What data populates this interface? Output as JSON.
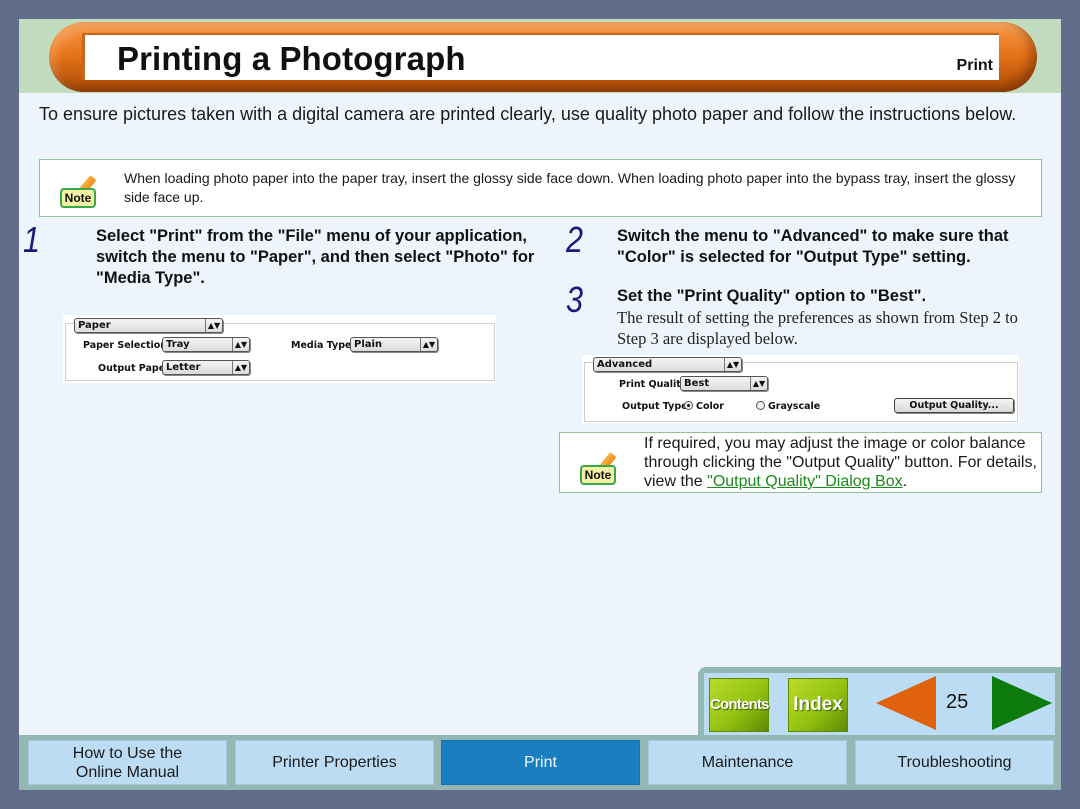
{
  "header": {
    "title": "Printing a Photograph",
    "section": "Print"
  },
  "intro": "To ensure pictures taken with a digital camera are printed clearly, use quality photo paper and follow the instructions below.",
  "note1": {
    "badge": "Note",
    "text": "When loading photo paper into the paper tray, insert the glossy side face down. When loading photo paper into the bypass tray, insert the glossy side face up."
  },
  "steps": [
    {
      "number": "1",
      "text": "Select \"Print\" from the \"File\" menu of your application, switch the menu to \"Paper\", and then select \"Photo\" for \"Media Type\"."
    },
    {
      "number": "2",
      "text": "Switch the menu to \"Advanced\" to make sure that \"Color\" is selected for \"Output Type\" setting."
    },
    {
      "number": "3",
      "text": "Set the \"Print Quality\" option to \"Best\".",
      "sub": "The result of setting the preferences as shown from Step 2 to Step 3 are displayed below."
    }
  ],
  "paper_panel": {
    "menu": "Paper",
    "paper_selection_label": "Paper Selection:",
    "paper_selection_value": "Tray",
    "media_type_label": "Media Type:",
    "media_type_value": "Plain",
    "output_paper_label": "Output Paper:",
    "output_paper_value": "Letter"
  },
  "advanced_panel": {
    "menu": "Advanced",
    "print_quality_label": "Print Quality:",
    "print_quality_value": "Best",
    "output_type_label": "Output Type:",
    "option_color": "Color",
    "option_grayscale": "Grayscale",
    "selected_output_type": "Color",
    "output_quality_button": "Output Quality..."
  },
  "note2": {
    "badge": "Note",
    "text_before": "If required, you may adjust the image or color balance through clicking the \"Output Quality\" button. For details, view the ",
    "link": "\"Output Quality\" Dialog Box",
    "text_after": "."
  },
  "nav": {
    "contents": "Contents",
    "index": "Index",
    "page": "25",
    "prev_icon": "triangle-left-icon",
    "next_icon": "triangle-right-icon"
  },
  "tabs": [
    {
      "label": "How to Use the Online Manual",
      "active": false
    },
    {
      "label": "Printer Properties",
      "active": false
    },
    {
      "label": "Print",
      "active": true
    },
    {
      "label": "Maintenance",
      "active": false
    },
    {
      "label": "Troubleshooting",
      "active": false
    }
  ],
  "colors": {
    "outer_bg": "#616d8a",
    "header_band": "#c2dcc0",
    "content_bg": "#eef4fb",
    "header_pill": "#e8741a",
    "tab_bg": "#bcdcf4",
    "tab_active": "#1a7fc1",
    "link": "#1b8a1b",
    "prev_arrow": "#e0620f",
    "next_arrow": "#0c7a0c",
    "nav_button": "#94c210"
  }
}
